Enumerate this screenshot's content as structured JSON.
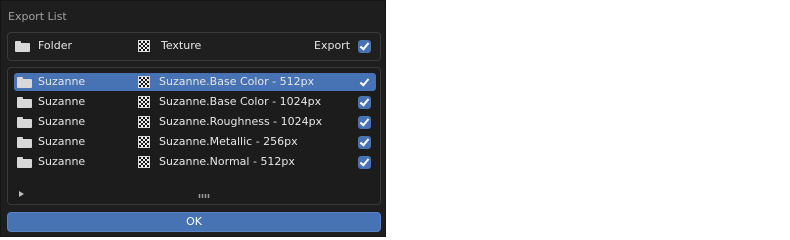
{
  "dialog": {
    "title": "Export List",
    "header": {
      "folder_label": "Folder",
      "texture_label": "Texture",
      "export_label": "Export",
      "export_checked": true
    },
    "rows": [
      {
        "folder": "Suzanne",
        "texture": "Suzanne.Base Color - 512px",
        "export": true,
        "selected": true
      },
      {
        "folder": "Suzanne",
        "texture": "Suzanne.Base Color - 1024px",
        "export": true,
        "selected": false
      },
      {
        "folder": "Suzanne",
        "texture": "Suzanne.Roughness - 1024px",
        "export": true,
        "selected": false
      },
      {
        "folder": "Suzanne",
        "texture": "Suzanne.Metallic - 256px",
        "export": true,
        "selected": false
      },
      {
        "folder": "Suzanne",
        "texture": "Suzanne.Normal - 512px",
        "export": true,
        "selected": false
      }
    ],
    "grip_label": "::::",
    "ok_label": "OK"
  },
  "icons": {
    "folder": "folder-icon",
    "texture": "checkerboard-texture-icon",
    "checkbox": "checkbox-checked-icon",
    "expand": "disclosure-triangle-icon"
  },
  "colors": {
    "accent": "#4772b3",
    "panel_bg": "#1e1e1e",
    "text": "#e6e6e6",
    "title_text": "#a0a0a0"
  }
}
